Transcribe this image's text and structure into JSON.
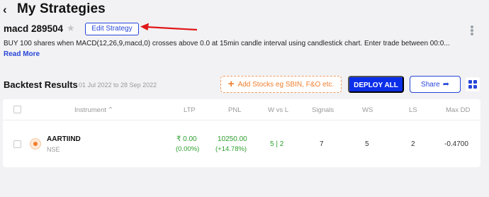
{
  "header": {
    "title": "My Strategies"
  },
  "strategy": {
    "name": "macd 289504",
    "edit_label": "Edit Strategy",
    "description": "BUY 100 shares when MACD(12,26,9,macd,0) crosses above 0.0 at 15min candle interval using candlestick chart. Enter trade between 00:0...",
    "read_more": "Read More"
  },
  "backtest": {
    "title": "Backtest Results",
    "dates": "01 Jul 2022 to 28 Sep 2022",
    "add_stocks_label": "Add Stocks eg SBIN, F&O etc.",
    "deploy_label": "DEPLOY ALL",
    "share_label": "Share"
  },
  "table": {
    "columns": {
      "instrument": "Instrument",
      "ltp": "LTP",
      "pnl": "PNL",
      "wvl": "W vs L",
      "signals": "Signals",
      "ws": "WS",
      "ls": "LS",
      "maxdd": "Max DD"
    },
    "rows": [
      {
        "symbol": "AARTIIND",
        "exchange": "NSE",
        "ltp": "₹ 0.00",
        "ltp_change": "(0.00%)",
        "pnl": "10250.00",
        "pnl_pct": "(+14.78%)",
        "wvl": "5 | 2",
        "signals": "7",
        "ws": "5",
        "ls": "2",
        "maxdd": "-0.4700"
      }
    ]
  },
  "colors": {
    "primary": "#0b2ee8",
    "accent_orange": "#f07e2e",
    "positive_green": "#2ea02e",
    "annotation_red": "#e01818"
  },
  "icons": [
    "back-chevron-icon",
    "star-icon",
    "kebab-menu-icon",
    "plus-icon",
    "share-arrow-icon",
    "grid-view-icon",
    "sort-up-icon",
    "stock-logo-icon"
  ]
}
